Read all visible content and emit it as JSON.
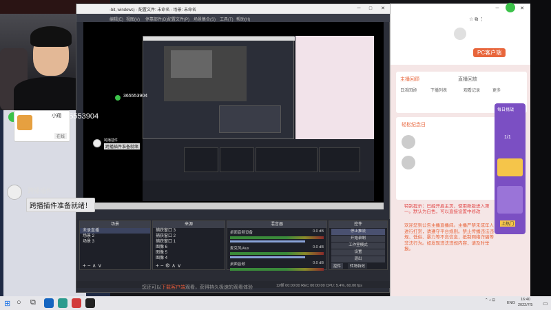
{
  "obs": {
    "title": "-bit, windows) - 配置文件: 未命名 - 场景: 未命名",
    "menu": [
      "编辑(E)",
      "视图(V)",
      "停靠部件(D)",
      "配置文件(P)",
      "场景集合(S)",
      "工具(T)",
      "帮助(H)"
    ],
    "docks": {
      "scenes_header": "场景",
      "scenes": [
        "未录直播",
        "场景 2",
        "场景 3"
      ],
      "sources_header": "来源",
      "sources": [
        "捕获窗口 3",
        "捕获窗口 2",
        "捕获窗口 1",
        "图像 6",
        "图像 5",
        "图像 4"
      ],
      "mixer_header": "混音器",
      "mixer": [
        {
          "name": "桌面音频设备",
          "db": "0.0 dB"
        },
        {
          "name": "麦克风/Aux",
          "db": "0.0 dB"
        },
        {
          "name": "桌面音频",
          "db": "0.0 dB"
        }
      ],
      "controls_header": "控件",
      "controls": [
        "停止推流",
        "开始录制",
        "工作室模式",
        "设置",
        "退出"
      ],
      "bottom_buttons": [
        "控件",
        "转场特效"
      ]
    },
    "status": "12帧  00:00:00     REC  00:00:00     CPU: 5.4%, 60.00 fps"
  },
  "promo": {
    "prefix": "您还可以",
    "highlight": "下载客户端",
    "suffix": "观看，获得持久极速的观看体验"
  },
  "chat": {
    "wechat_id": "365553904",
    "wechat_id_small": "365553904",
    "card_name": "小翔",
    "card_button": "在线",
    "plugin_name": "跨播插件",
    "plugin_message": "跨播插件准备就绪！",
    "plugin_name_small": "跨播插件",
    "plugin_message_small": "跨播插件准备就绪"
  },
  "browser": {
    "tabs": [
      "主播回顾",
      "直播回放"
    ],
    "subtabs": [
      "日活回顾",
      "下播列表",
      "观看记录",
      "更多"
    ],
    "pc_button": "PC客户端",
    "section": "轻松纪念日",
    "red_text": "特别提示：已经开启主页，使用新版进入第一。默认为白色，可以直接设置中修改",
    "body_text": "欢迎您到公告主播直播间。主播严禁未成年人进行打赏，请遵守平台规则。禁止传播违法违规、低俗、暴力等不良信息，抵制网络诈骗等非法行为。如发现违法违规内容，请及时举报。",
    "side_panel": [
      "每日挑战",
      "1/1",
      "去签到",
      "上热门"
    ]
  },
  "taskbar": {
    "lang": "ENG",
    "time": "16:40",
    "date": "2022/7/5"
  }
}
